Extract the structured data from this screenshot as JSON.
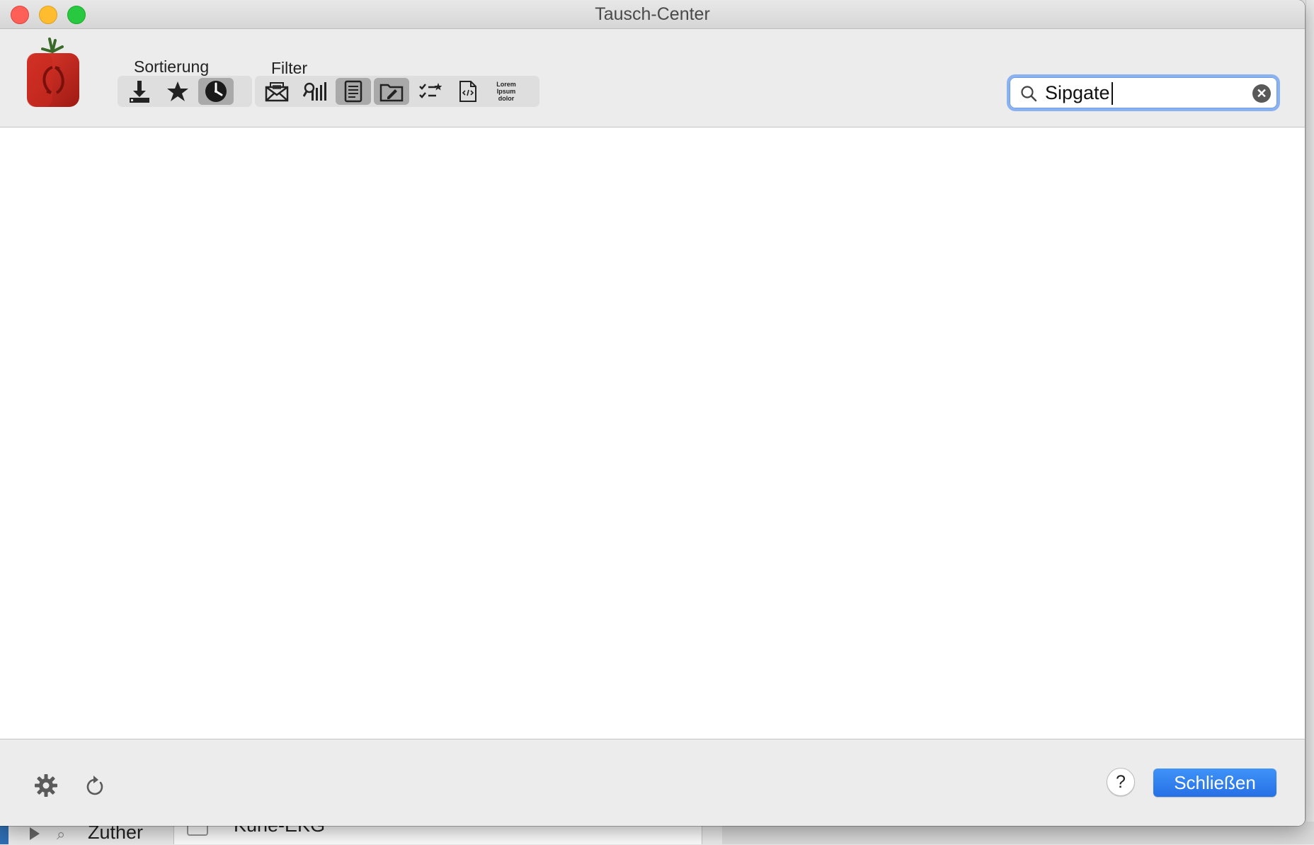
{
  "window": {
    "title": "Tausch-Center"
  },
  "toolbar": {
    "sort_label": "Sortierung",
    "filter_label": "Filter",
    "sort_buttons": [
      {
        "icon": "download-icon",
        "selected": false
      },
      {
        "icon": "star-icon",
        "selected": false
      },
      {
        "icon": "clock-icon",
        "selected": true
      }
    ],
    "filter_buttons": [
      {
        "icon": "envelope-icon",
        "selected": false
      },
      {
        "icon": "chart-icon",
        "selected": false
      },
      {
        "icon": "document-icon",
        "selected": true
      },
      {
        "icon": "folder-edit-icon",
        "selected": true
      },
      {
        "icon": "checklist-icon",
        "selected": false
      },
      {
        "icon": "code-file-icon",
        "selected": false
      },
      {
        "icon": "lorem-ipsum-icon",
        "selected": false
      }
    ],
    "lorem_text": {
      "line1": "Lorem",
      "line2": "Ipsum",
      "line3": "dolor"
    }
  },
  "search": {
    "value": "Sipgate"
  },
  "footer": {
    "help_label": "?",
    "close_label": "Schließen"
  },
  "background": {
    "sidebar_text": "Zuther",
    "list_text": "Kune-EKG"
  },
  "colors": {
    "primary_button": "#2f7ef0",
    "focus_ring": "#8ab2f0"
  }
}
